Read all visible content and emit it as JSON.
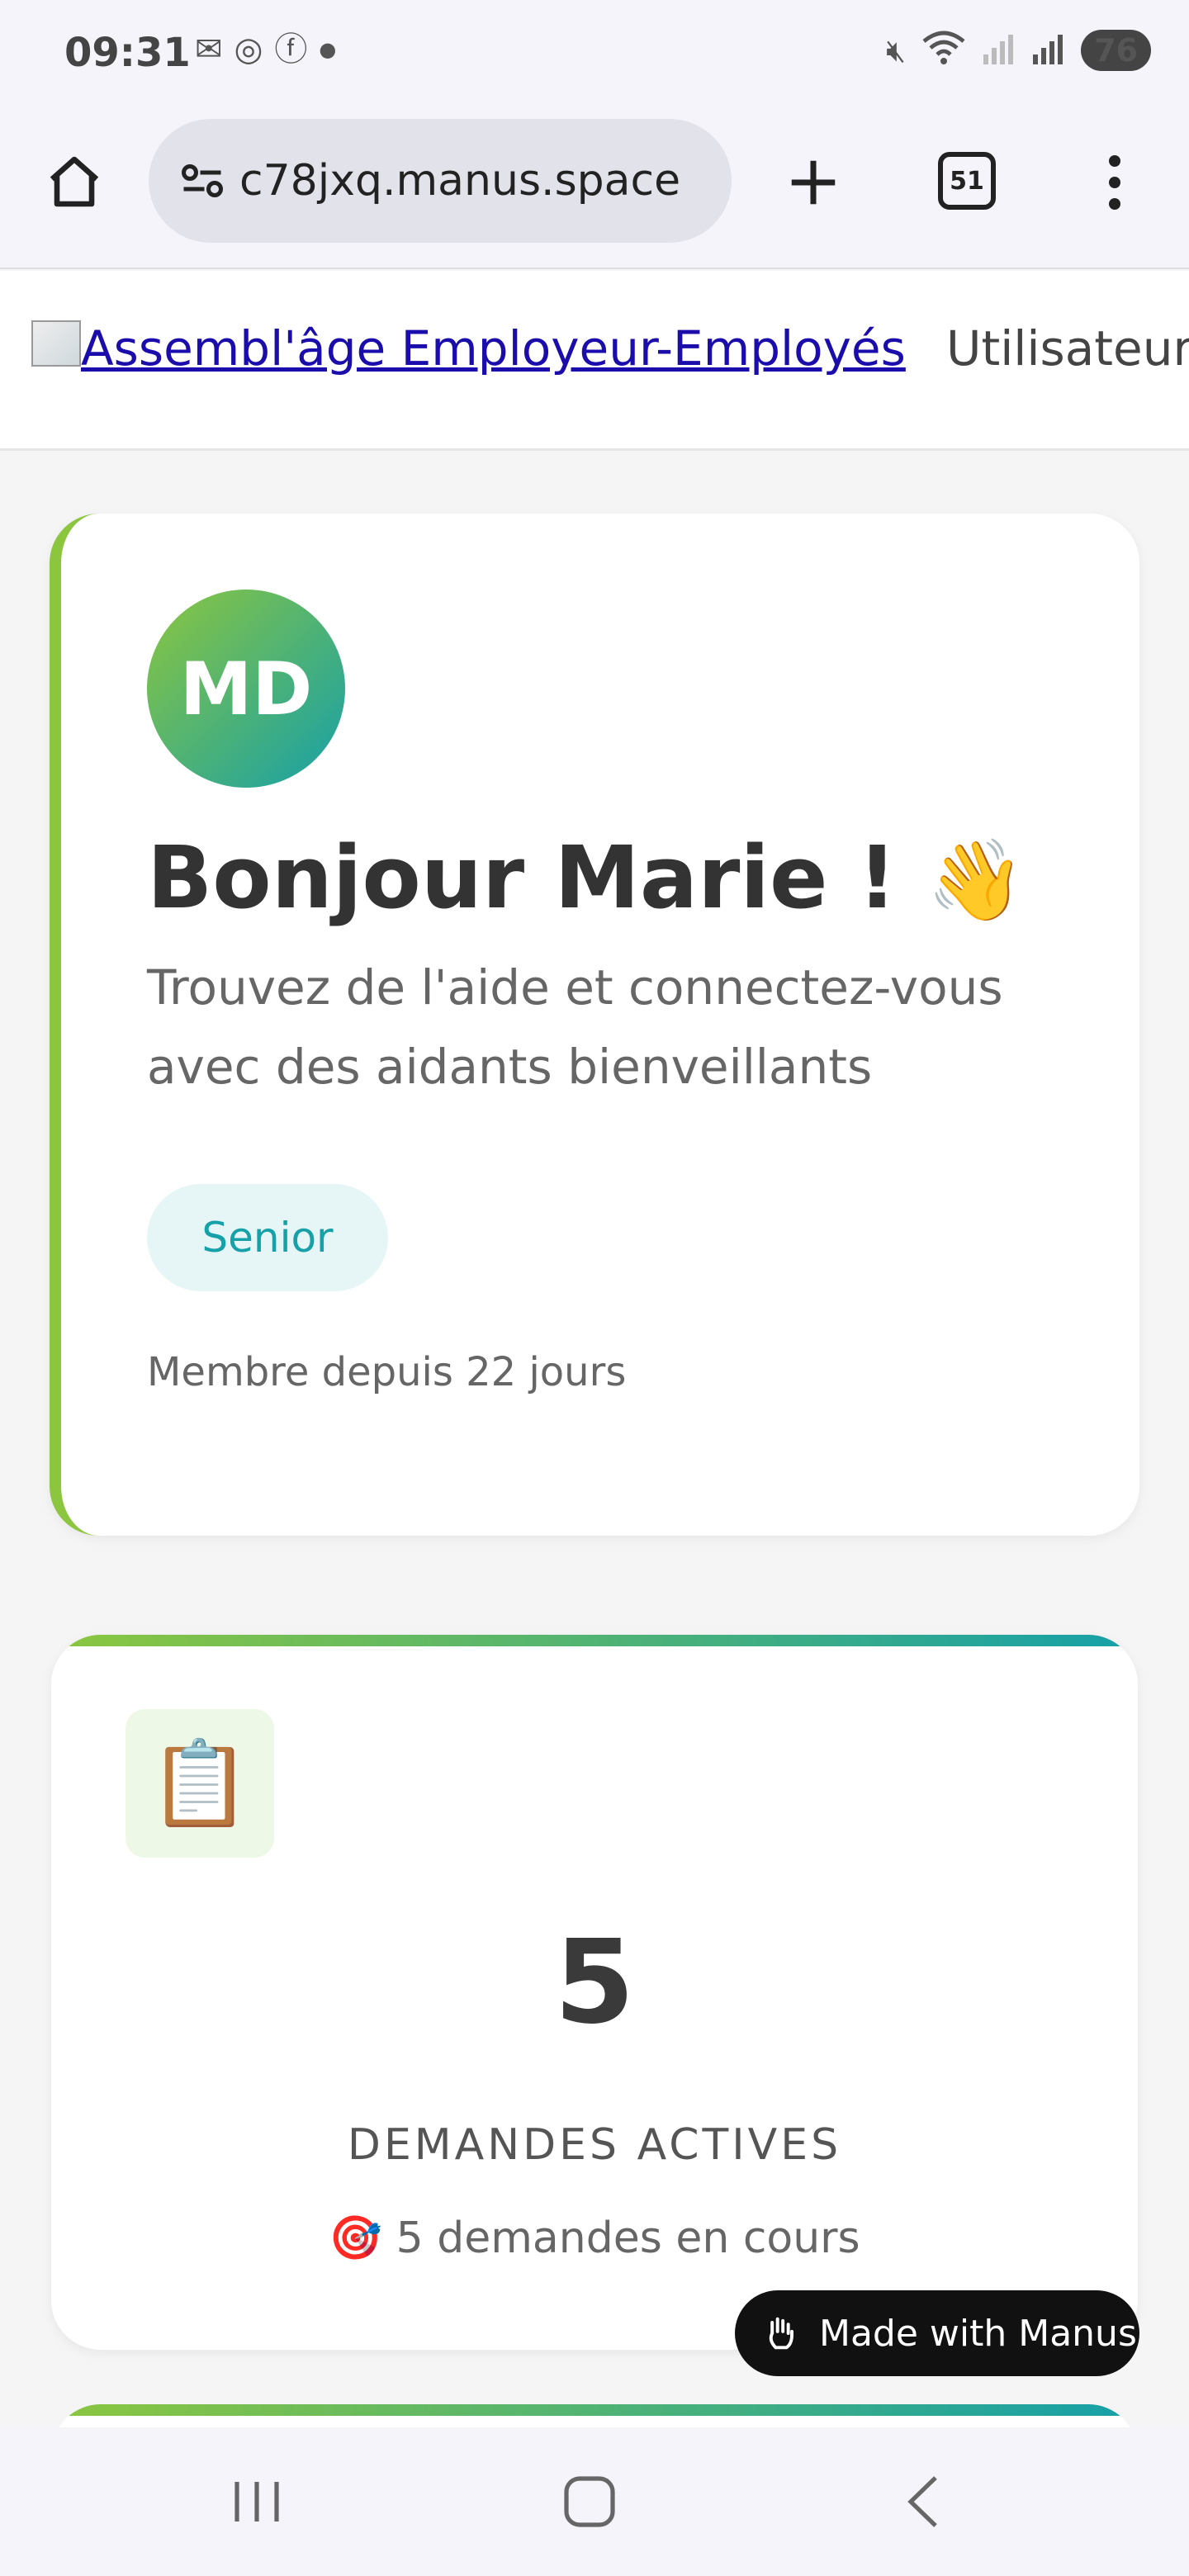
{
  "status_bar": {
    "time": "09:31",
    "battery": "76",
    "left_icons": [
      "gmail-icon",
      "whatsapp-icon",
      "facebook-icon",
      "dot-icon"
    ],
    "right_icons": [
      "mute-icon",
      "wifi-icon",
      "signal-r-icon",
      "signal-icon"
    ]
  },
  "browser": {
    "url": "c78jxq.manus.space",
    "tab_count": "51"
  },
  "site_header": {
    "brand_link": "Assembl'âge Employeur-Employés",
    "user_label": "Utilisateur"
  },
  "profile_card": {
    "initials": "MD",
    "greeting": "Bonjour Marie !",
    "greeting_emoji": "👋",
    "subtitle": "Trouvez de l'aide et connectez-vous avec des aidants bienveillants",
    "role": "Senior",
    "member_since": "Membre depuis 22 jours"
  },
  "stat_card": {
    "icon": "📋",
    "value": "5",
    "label": "DEMANDES ACTIVES",
    "detail_icon": "🎯",
    "detail": "5 demandes en cours"
  },
  "manus_badge": {
    "label": "Made with Manus"
  },
  "colors": {
    "accent_green": "#8cc63f",
    "accent_teal": "#16a0a8",
    "link_blue": "#1a0dab"
  }
}
